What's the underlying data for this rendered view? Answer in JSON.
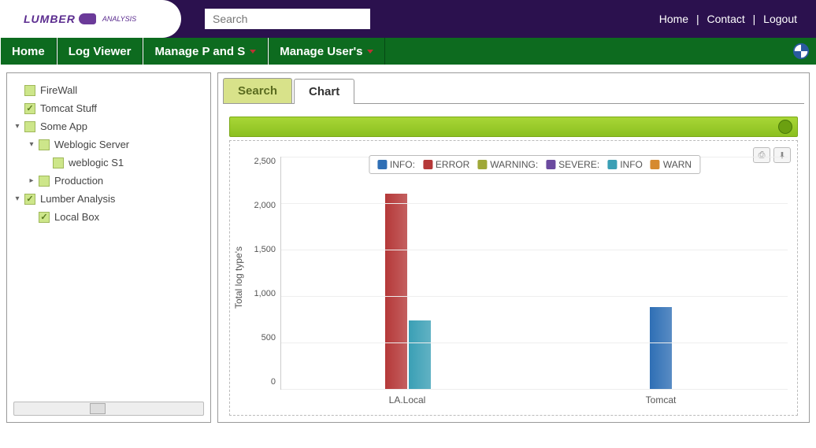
{
  "header": {
    "logo_main": "LUMBER",
    "logo_sub": "ANALYSIS",
    "search_placeholder": "Search",
    "links": {
      "home": "Home",
      "contact": "Contact",
      "logout": "Logout"
    }
  },
  "nav": {
    "items": [
      {
        "label": "Home",
        "dropdown": false
      },
      {
        "label": "Log Viewer",
        "dropdown": false
      },
      {
        "label": "Manage P and S",
        "dropdown": true
      },
      {
        "label": "Manage User's",
        "dropdown": true
      }
    ]
  },
  "tree": [
    {
      "label": "FireWall",
      "indent": 0,
      "checked": false,
      "toggle": ""
    },
    {
      "label": "Tomcat Stuff",
      "indent": 0,
      "checked": true,
      "toggle": ""
    },
    {
      "label": "Some App",
      "indent": 0,
      "checked": false,
      "toggle": "▾"
    },
    {
      "label": "Weblogic Server",
      "indent": 1,
      "checked": false,
      "toggle": "▾"
    },
    {
      "label": "weblogic S1",
      "indent": 2,
      "checked": false,
      "toggle": ""
    },
    {
      "label": "Production",
      "indent": 1,
      "checked": false,
      "toggle": "▸"
    },
    {
      "label": "Lumber Analysis",
      "indent": 0,
      "checked": true,
      "toggle": "▾"
    },
    {
      "label": "Local Box",
      "indent": 1,
      "checked": true,
      "toggle": ""
    }
  ],
  "tabs": {
    "search": "Search",
    "chart": "Chart"
  },
  "chart_data": {
    "type": "bar",
    "ylabel": "Total log type's",
    "ylim": [
      0,
      2500
    ],
    "yticks": [
      "2,500",
      "2,000",
      "1,500",
      "1,000",
      "500",
      "0"
    ],
    "categories": [
      "LA.Local",
      "Tomcat"
    ],
    "series": [
      {
        "name": "INFO:",
        "color": "#2f6fb5",
        "values": [
          null,
          880
        ]
      },
      {
        "name": "ERROR",
        "color": "#b53838",
        "values": [
          2100,
          null
        ]
      },
      {
        "name": "WARNING:",
        "color": "#9fa838",
        "values": [
          null,
          null
        ]
      },
      {
        "name": "SEVERE:",
        "color": "#6b4a9f",
        "values": [
          null,
          null
        ]
      },
      {
        "name": "INFO",
        "color": "#3a9fb5",
        "values": [
          740,
          null
        ]
      },
      {
        "name": "WARN",
        "color": "#d68a2f",
        "values": [
          null,
          null
        ]
      }
    ]
  }
}
